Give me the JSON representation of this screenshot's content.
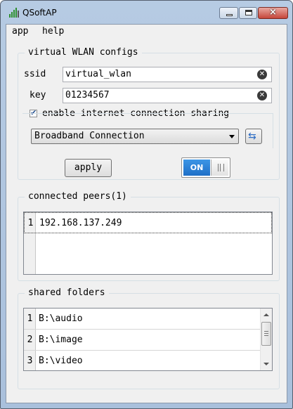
{
  "window": {
    "title": "QSoftAP",
    "close_glyph": "×"
  },
  "menu": {
    "items": [
      "app",
      "help"
    ]
  },
  "wlan": {
    "group_title": "virtual WLAN configs",
    "ssid_label": "ssid",
    "ssid_value": "virtual_wlan",
    "key_label": "key",
    "key_value": "01234567",
    "sharing_label": "enable internet connection sharing",
    "sharing_checked": true,
    "connection_value": "Broadband Connection",
    "apply_label": "apply",
    "toggle_label": "ON",
    "toggle_on": true
  },
  "peers": {
    "group_title": "connected peers(1)",
    "rows": [
      {
        "num": "1",
        "text": "192.168.137.249"
      }
    ]
  },
  "folders": {
    "group_title": "shared folders",
    "rows": [
      {
        "num": "1",
        "text": "B:\\audio"
      },
      {
        "num": "2",
        "text": "B:\\image"
      },
      {
        "num": "3",
        "text": "B:\\video"
      }
    ]
  },
  "colors": {
    "toggle_on": "#1e6fc7",
    "titlebar": "#b6cbe3",
    "close_button": "#c6463a"
  },
  "icons": [
    "app-icon",
    "minimize-icon",
    "maximize-icon",
    "close-icon",
    "clear-icon",
    "refresh-icon",
    "dropdown-arrow-icon",
    "checkbox-check-icon"
  ]
}
